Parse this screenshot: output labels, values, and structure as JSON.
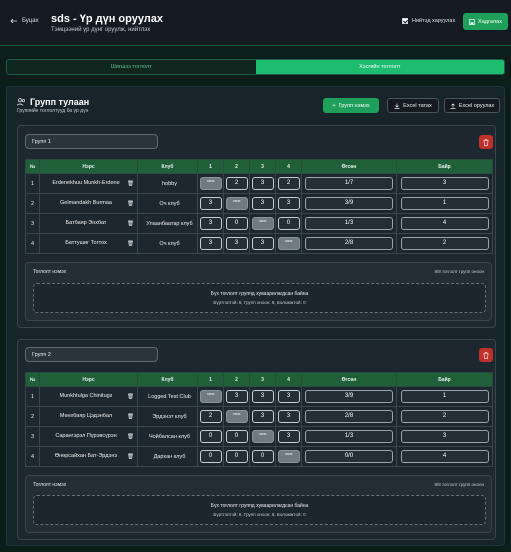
{
  "header": {
    "back_label": "Буцах",
    "title": "sds - Үр дүн оруулах",
    "subtitle": "Тэмцээний үр дүнг оруулж, нийтлэх",
    "checkbox_label": "Нийтэд харуулах",
    "save_label": "Хадгалах"
  },
  "tabs": [
    {
      "label": "Шигшээ тоглолт"
    },
    {
      "label": "Хэсгийн тоглолт"
    }
  ],
  "panel": {
    "title": "Групп тулаан",
    "subtitle": "Группийн тоглолтууд ба үр дүн",
    "add_group_label": "Групп нэмэх",
    "excel_import_label": "Excel татах",
    "excel_export_label": "Excel оруулах"
  },
  "table_headers": [
    "№",
    "Нэрс",
    "Клуб",
    "1",
    "2",
    "3",
    "4",
    "Өгсөн",
    "Байр"
  ],
  "groups": [
    {
      "name": "Групп 1",
      "rows": [
        {
          "no": "1",
          "name": "Erdenekhuu Munkh-Erdene",
          "club": "hobby",
          "scores": [
            "*****",
            "2",
            "3",
            "2"
          ],
          "given": "1/7",
          "rank": "3"
        },
        {
          "no": "2",
          "name": "Gelmandakh Burmaa",
          "club": "Оч клуб",
          "scores": [
            "3",
            "*****",
            "3",
            "3"
          ],
          "given": "3/9",
          "rank": "1"
        },
        {
          "no": "3",
          "name": "Батбаяр Энхбат",
          "club": "Улаанбаатар клуб",
          "scores": [
            "3",
            "0",
            "*****",
            "0"
          ],
          "given": "1/3",
          "rank": "4"
        },
        {
          "no": "4",
          "name": "Баттушиг Тогтох",
          "club": "Оч клуб",
          "scores": [
            "3",
            "3",
            "3",
            "*****"
          ],
          "given": "2/8",
          "rank": "2"
        }
      ],
      "summary_title": "Тоглолт нэмэх",
      "summary_right": "8/8 тоглолт групп оноон",
      "summary_main": "Бүх тоглолт группд хуваарилагдсан байна",
      "summary_stats": "Бүртгэлтэй: 8, Групп оноон: 8, Боломжтой: 0"
    },
    {
      "name": "Групп 2",
      "rows": [
        {
          "no": "1",
          "name": "Munkhtulga Chinitugs",
          "club": "Logged Test Club",
          "scores": [
            "*****",
            "3",
            "3",
            "3"
          ],
          "given": "3/9",
          "rank": "1"
        },
        {
          "no": "2",
          "name": "Мөнхбаяр Цэдэнбал",
          "club": "Эрдэнэт клуб",
          "scores": [
            "2",
            "*****",
            "3",
            "3"
          ],
          "given": "2/8",
          "rank": "2"
        },
        {
          "no": "3",
          "name": "Сарангэрэл Пүрэвсүрэн",
          "club": "Чойбалсан клуб",
          "scores": [
            "0",
            "0",
            "*****",
            "3"
          ],
          "given": "1/3",
          "rank": "3"
        },
        {
          "no": "4",
          "name": "Өнөрсайхан Бат-Эрдэнэ",
          "club": "Дархан клуб",
          "scores": [
            "0",
            "0",
            "0",
            "*****"
          ],
          "given": "0/0",
          "rank": "4"
        }
      ],
      "summary_title": "Тоглолт нэмэх",
      "summary_right": "8/8 тоглолт групп оноон",
      "summary_main": "Бүх тоглолт группд хуваарилагдсан байна",
      "summary_stats": "Бүртгэлтэй: 8, Групп оноон: 8, Боломжтой: 0"
    }
  ],
  "colors": {
    "accent": "#1ebc6e",
    "danger": "#c0312b",
    "table_header": "#1f5f3a"
  }
}
